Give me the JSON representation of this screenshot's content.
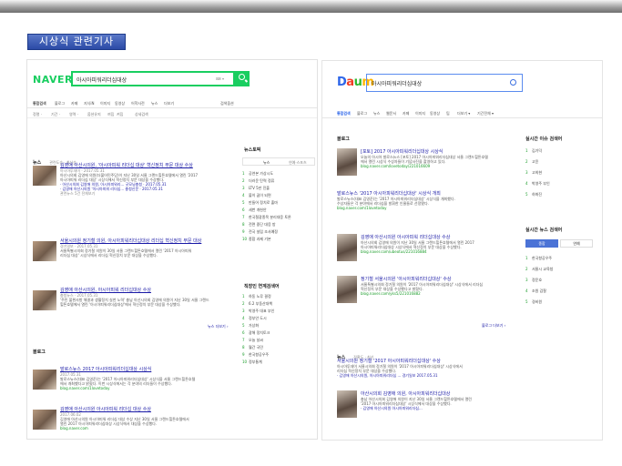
{
  "slide": {
    "title": "시상식 관련기사"
  },
  "naver": {
    "logo": "NAVER",
    "query": "아시아피워리더십대상",
    "keyboard_hint": "⌨ ▾",
    "tabs": [
      "통합검색",
      "블로그",
      "카페",
      "지식iN",
      "이미지",
      "동영상",
      "어학사전",
      "뉴스",
      "더보기",
      "검색옵션"
    ],
    "options": [
      "정렬 ·",
      "기간 ·",
      "영역 ·",
      "옵션유지",
      "꺼짐",
      "켜짐",
      "상세검색"
    ],
    "news_header": "뉴스",
    "news_sub": "관련도순 · 최신순",
    "news": [
      {
        "headline": "김영애 아산시의원, '아시아피워 리더십 대상' 혁신정치 부문 대상 수상",
        "meta": "아시아투데이 · 2017.05.31",
        "lines": [
          "아산시의회 김영애 의원(더불어민주당)이 지난 30일 서울 그랜드힐튼호텔에서 열린 '2017",
          "아시아피워 리더십 대상' 시상식에서 혁신정치 부문 대상을 수상했다."
        ],
        "related": [
          "· 아산시의회 김영애 의원, 아시아피워리...  굿모닝충청 · 2017.05.31",
          "· 김영애 아산시의원 '아시아피워 리더십...  충청신문 · 2017.05.31"
        ],
        "more": "관련뉴스 5건 전체보기"
      },
      {
        "headline": "서울시의원 정기철 의원, 아시아피워리더십대상 리더십 혁신정치 부문 대상",
        "meta": "경기일보 · 2017.05.31",
        "lines": [
          "서울특별시의회 정기철 의원이 30일 서울 그랜드힐튼호텔에서 열린 '2017 아시아피워",
          "리더십 대상' 시상식에서 리더십 혁신정치 부문 대상을 수상했다."
        ],
        "related": [],
        "more": ""
      },
      {
        "headline": "김영애 아산시의원, 아시아피워 리더십대상 수상",
        "meta": "충청뉴스 · 2017.05.31",
        "lines": [
          "'주민 불편사항 해결과 생활정치 실천 노력' 충남 아산시의회 김영애 의원이 지난 30일 서울 그랜드",
          "힐튼호텔에서 열린 '아시아피워리더십대상'에서 혁신정치 부문 대상을 수상했다."
        ],
        "related": [],
        "more": "뉴스 더보기 ›"
      }
    ],
    "blog_header": "블로그",
    "blogs": [
      {
        "headline": "발로스뉴스 2017 아시아피워리더십대상 시상식",
        "meta": "2017.05.31",
        "lines": [
          "발로스뉴스(대표 김영준)는 '2017 아시아피워리더십대상' 시상식을 서울 그랜드힐튼호텔",
          "에서 개최했다고 밝혔다. 이번 시상식에서는 각 분야의 리더들이 수상했다."
        ],
        "source": "blog.naver.com/1lovetoday"
      },
      {
        "headline": "김영애 아산시의원 아시아피워 리더십 대상 수상",
        "meta": "2017.06.02",
        "lines": [
          "김영애 아산시의원 아시아피워 리더십 대상 수상 지난 30일 서울 그랜드힐튼호텔에서",
          "열린 2017 아시아피워리더십대상 시상식에서 대상을 수상했다."
        ],
        "source": "blog.naver.com"
      }
    ],
    "right_header": "뉴스토픽",
    "right_tabs": [
      "뉴스",
      "연예·스포츠"
    ],
    "right_items": [
      "공연본 가상시도",
      "더러운 탄력 정류",
      "LTV 5만 진출",
      "불이 꿈이 되면",
      "만들어 정치로 출마",
      "세번 개헌안",
      "한국철광종목 분리대응 토론",
      "전면 중단 대응 방",
      "전국 설립 조사예정",
      "종합 과제 기본"
    ],
    "right_header2": "직장인 연계검색어",
    "right_items2": [
      "하동 노루 결정",
      "6.2 부동산대책",
      "박영주 대표 부인",
      "정부안 도시",
      "가상화",
      "광해 정치토크",
      "오늘 날씨",
      "월간 국민",
      "한국항공우주",
      "정부통계"
    ]
  },
  "daum": {
    "logo_letters": [
      "D",
      "a",
      "u",
      "m"
    ],
    "query": "아시아피워리더십대상",
    "tabs": [
      "통합검색",
      "블로그",
      "뉴스",
      "웹문서",
      "카페",
      "이미지",
      "동영상",
      "팁",
      "더보기 ▾",
      "기간전체 ▾"
    ],
    "blog_header": "블로그",
    "blogs": [
      {
        "headline": "[포토] 2017 아시아피워리더십대상 시상식",
        "lines": [
          "오늘의 아시아 발로스뉴스 [포토] 2017 아시아피워리더십대상 서울 그랜드힐튼호텔",
          "에서 열린 시상식 수상자들이 기념사진을 촬영하고 있다."
        ],
        "source": "blog.naver.com/lovetoday/221016609"
      },
      {
        "headline": "발로스뉴스 '2017 아시아피워리더십대상' 시상식 개최",
        "lines": [
          "발로스뉴스(대표 김영준)는 '2017 아시아피워리더십대상' 시상식을 개최했다.",
          "수상자들은 각 분야에서 리더십을 발휘한 인물들로 선정됐다."
        ],
        "source": "blog.naver.com/1lovetoday"
      },
      {
        "headline": "김영애 아산시의원 아시아피워 리더십대상 수상",
        "lines": [
          "아산시의회 김영애 의원이 지난 30일 서울 그랜드힐튼호텔에서 열린 2017",
          "아시아피워리더십대상 시상식에서 혁신정치 부문 대상을 수상했다."
        ],
        "source": "blog.naver.com/ubeotus/221016884"
      },
      {
        "headline": "정기철 서울시의원 '아시아피워리더십대상' 수상",
        "lines": [
          "서울특별시의회 정기철 의원이 '2017 아시아피워리더십대상' 시상식에서 리더십",
          "혁신정치 부문 대상을 수상했다고 밝혔다."
        ],
        "source": "blog.naver.com/yks5/221016882"
      }
    ],
    "blog_more": "블로그 더보기 ›",
    "news_header": "뉴스",
    "news_sub": "정확도 · 최신",
    "news": [
      {
        "headline": "서울시의원 정기철 '2017 아시아피워리더십대상' 수상",
        "lines": [
          "아시아투데이 서울시의회 정기철 의원이 '2017 아시아피워리더십대상' 시상식에서",
          "리더십 혁신정치 부문 대상을 수상했다."
        ],
        "related": "· 김영애 아산시의원, 아시아피워리더십 ...  경기일보 2017.05.31"
      },
      {
        "headline": "아산시의회 김영애 의원, 아시아피워리더십대상",
        "lines": [
          "충남 아산시의회 김영애 의원이 지난 30일 서울 그랜드힐튼호텔에서 열린",
          "'2017 아시아피워리더십대상' 시상식에서 대상을 수상했다."
        ],
        "related": "· 김영애 아산시의원 아시아피워리더십..."
      }
    ],
    "side_header": "실시간 이슈 검색어",
    "side_items": [
      "김기덕",
      "고윤",
      "고희현",
      "박영주 부인",
      "하화진"
    ],
    "side_header2": "실시간 뉴스 검색어",
    "side_tabs": [
      "종합",
      "연예"
    ],
    "side_items2": [
      "한국항공우주",
      "서울시 교육청",
      "정운호",
      "조원 감찰",
      "경비원"
    ]
  }
}
